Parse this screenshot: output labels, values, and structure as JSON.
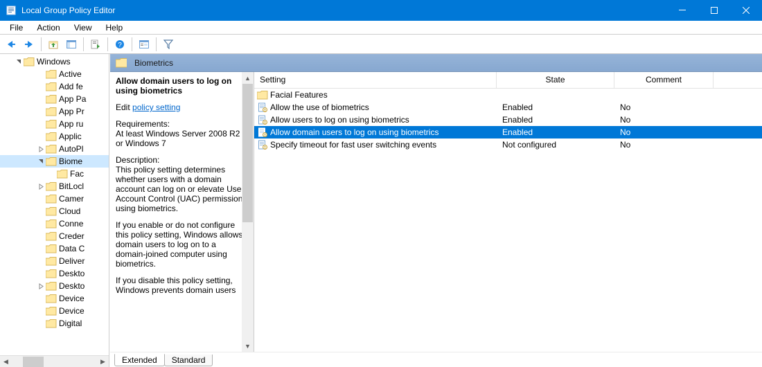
{
  "titlebar": {
    "title": "Local Group Policy Editor"
  },
  "menubar": [
    "File",
    "Action",
    "View",
    "Help"
  ],
  "tree": {
    "root_label": "Windows",
    "items": [
      {
        "label": "Active",
        "indent": 2
      },
      {
        "label": "Add fe",
        "indent": 2
      },
      {
        "label": "App Pa",
        "indent": 2
      },
      {
        "label": "App Pr",
        "indent": 2
      },
      {
        "label": "App ru",
        "indent": 2
      },
      {
        "label": "Applic",
        "indent": 2
      },
      {
        "label": "AutoPl",
        "indent": 2,
        "expander": "closed"
      },
      {
        "label": "Biome",
        "indent": 2,
        "expander": "open",
        "sel": true
      },
      {
        "label": "Fac",
        "indent": 3
      },
      {
        "label": "BitLocl",
        "indent": 2,
        "expander": "closed"
      },
      {
        "label": "Camer",
        "indent": 2
      },
      {
        "label": "Cloud",
        "indent": 2
      },
      {
        "label": "Conne",
        "indent": 2
      },
      {
        "label": "Creder",
        "indent": 2
      },
      {
        "label": "Data C",
        "indent": 2
      },
      {
        "label": "Deliver",
        "indent": 2
      },
      {
        "label": "Deskto",
        "indent": 2
      },
      {
        "label": "Deskto",
        "indent": 2,
        "expander": "closed"
      },
      {
        "label": "Device",
        "indent": 2
      },
      {
        "label": "Device",
        "indent": 2
      },
      {
        "label": "Digital",
        "indent": 2
      }
    ]
  },
  "header": {
    "title": "Biometrics"
  },
  "detail": {
    "title": "Allow domain users to log on using biometrics",
    "edit_prefix": "Edit",
    "edit_link": "policy setting",
    "req_label": "Requirements:",
    "req_value": "At least Windows Server 2008 R2 or Windows 7",
    "desc_label": "Description:",
    "desc_p1": "This policy setting determines whether users with a domain account can log on or elevate User Account Control (UAC) permissions using biometrics.",
    "desc_p2": "If you enable or do not configure this policy setting, Windows allows domain users to log on to a domain-joined computer using biometrics.",
    "desc_p3": "If you disable this policy setting, Windows prevents domain users"
  },
  "columns": {
    "setting": "Setting",
    "state": "State",
    "comment": "Comment"
  },
  "rows": [
    {
      "type": "folder",
      "name": "Facial Features",
      "state": "",
      "comment": ""
    },
    {
      "type": "policy",
      "name": "Allow the use of biometrics",
      "state": "Enabled",
      "comment": "No"
    },
    {
      "type": "policy",
      "name": "Allow users to log on using biometrics",
      "state": "Enabled",
      "comment": "No"
    },
    {
      "type": "policy",
      "name": "Allow domain users to log on using biometrics",
      "state": "Enabled",
      "comment": "No",
      "sel": true
    },
    {
      "type": "policy",
      "name": "Specify timeout for fast user switching events",
      "state": "Not configured",
      "comment": "No"
    }
  ],
  "tabs": {
    "extended": "Extended",
    "standard": "Standard"
  }
}
